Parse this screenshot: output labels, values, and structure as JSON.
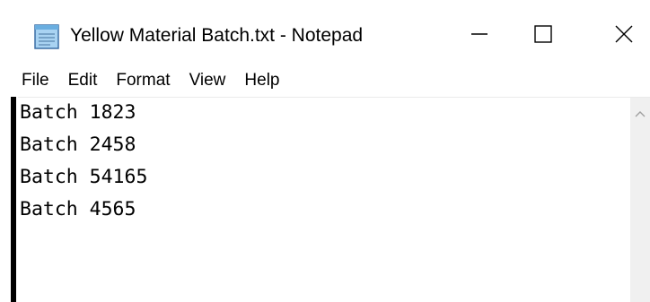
{
  "window": {
    "title": "Yellow Material Batch.txt - Notepad",
    "icon": "notepad-icon"
  },
  "caption_buttons": {
    "minimize": "minimize-icon",
    "maximize": "maximize-icon",
    "close": "close-icon"
  },
  "menu": {
    "items": [
      "File",
      "Edit",
      "Format",
      "View",
      "Help"
    ]
  },
  "editor": {
    "lines": [
      "Batch 1823",
      "Batch 2458",
      "Batch 54165",
      "Batch 4565"
    ]
  },
  "scrollbar": {
    "up_arrow": "chevron-up-icon"
  }
}
